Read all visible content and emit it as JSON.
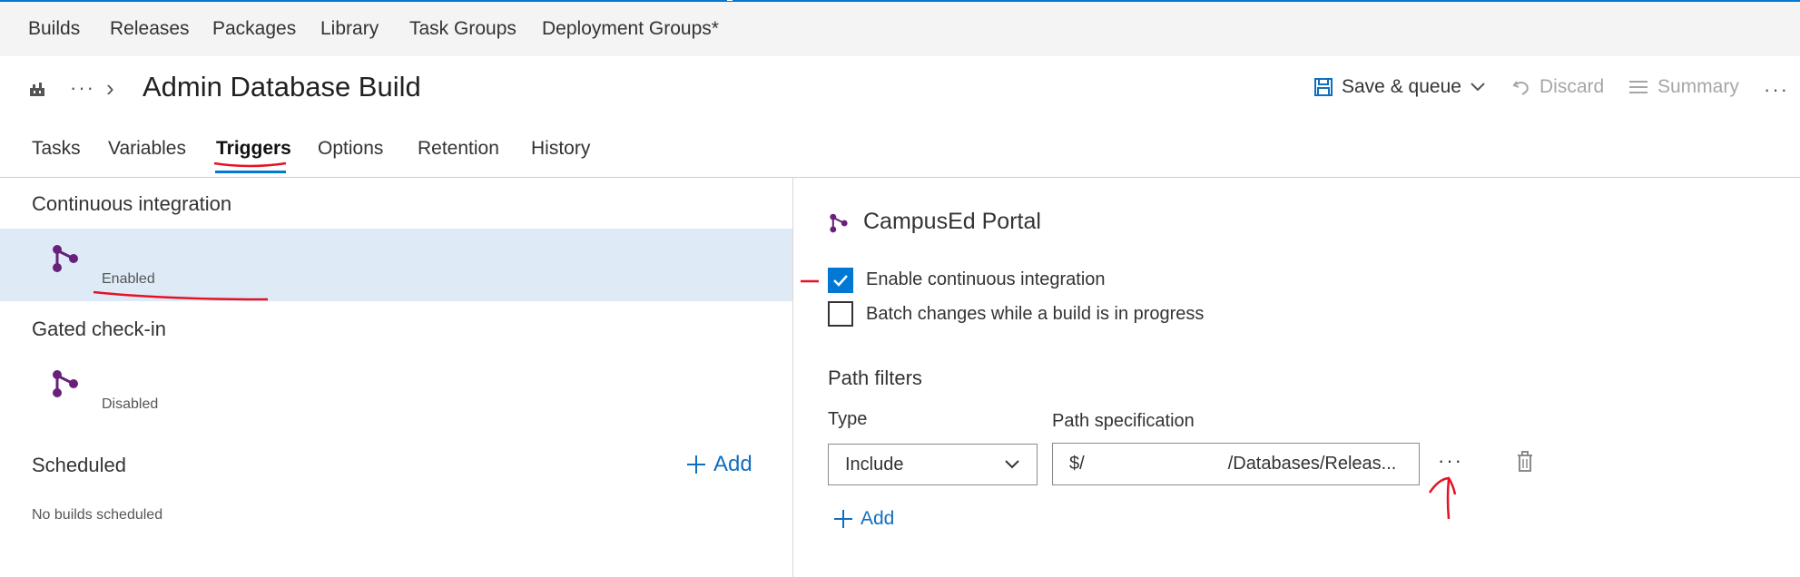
{
  "top_nav": {
    "items": [
      "Builds",
      "Releases",
      "Packages",
      "Library",
      "Task Groups",
      "Deployment Groups*"
    ]
  },
  "header": {
    "breadcrumb_ellipsis": "···",
    "breadcrumb_separator": "›",
    "title": "Admin Database Build",
    "save_queue_label": "Save & queue",
    "discard_label": "Discard",
    "summary_label": "Summary",
    "more_label": "···"
  },
  "tabs": [
    {
      "label": "Tasks",
      "active": false
    },
    {
      "label": "Variables",
      "active": false
    },
    {
      "label": "Triggers",
      "active": true
    },
    {
      "label": "Options",
      "active": false
    },
    {
      "label": "Retention",
      "active": false
    },
    {
      "label": "History",
      "active": false
    }
  ],
  "left_pane": {
    "ci_title": "Continuous integration",
    "ci_status": "Enabled",
    "gated_title": "Gated check-in",
    "gated_status": "Disabled",
    "scheduled_title": "Scheduled",
    "scheduled_add": "Add",
    "scheduled_empty": "No builds scheduled"
  },
  "right_pane": {
    "repo_name": "CampusEd Portal",
    "enable_ci_label": "Enable continuous integration",
    "enable_ci_checked": true,
    "batch_label": "Batch changes while a build is in progress",
    "batch_checked": false,
    "path_filters_title": "Path filters",
    "type_label": "Type",
    "path_spec_label": "Path specification",
    "type_value": "Include",
    "path_prefix": "$/",
    "path_value": "/Databases/Releas...",
    "ellipsis_label": "···",
    "add_label": "Add"
  },
  "icons": {
    "build": "build-definition-icon",
    "trigger": "branch-trigger-icon",
    "save": "floppy-disk-icon",
    "discard": "undo-icon",
    "summary": "list-icon",
    "delete": "trash-icon"
  },
  "colors": {
    "accent": "#0078d4",
    "trigger_icon": "#68217a",
    "selected_row": "#deebf7",
    "annotation": "#e81123"
  }
}
